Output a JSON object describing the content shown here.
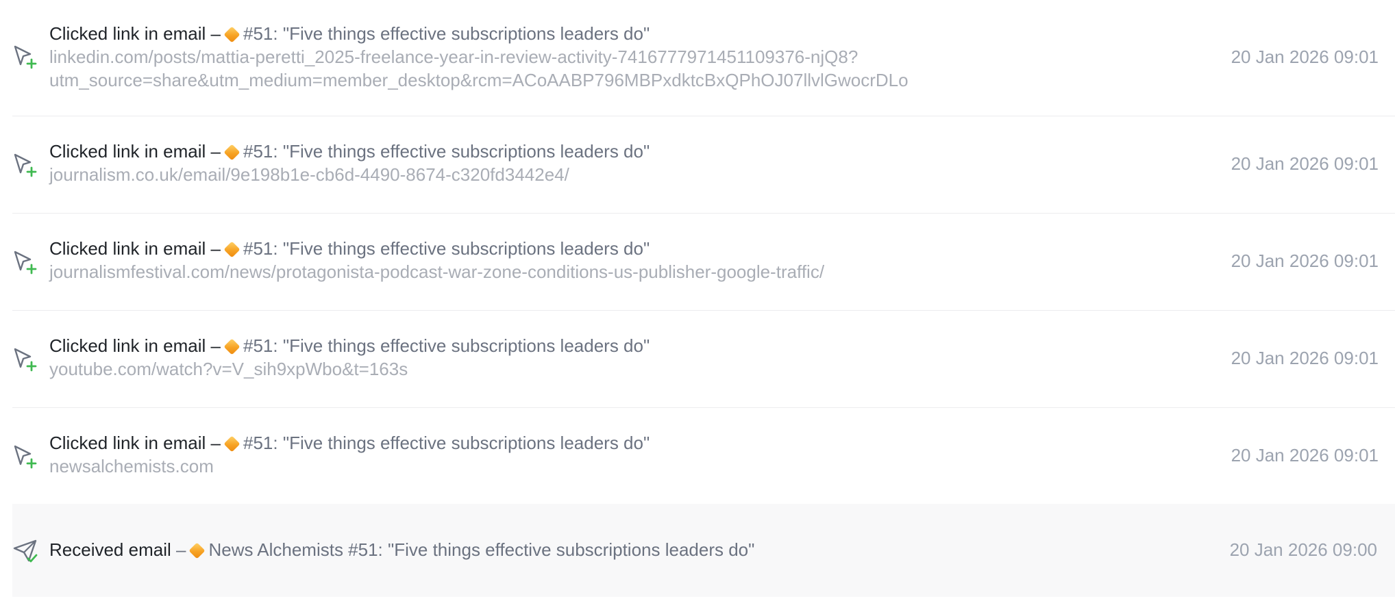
{
  "activities": [
    {
      "type": "click",
      "icon": "cursor-click-icon",
      "event_label": "Clicked link in email",
      "separator": "–",
      "email_label": "#51: \"Five things effective subscriptions leaders do\"",
      "url_line1": "linkedin.com/posts/mattia-peretti_2025-freelance-year-in-review-activity-7416777971451109376-njQ8?",
      "url_line2": "utm_source=share&utm_medium=member_desktop&rcm=ACoAABP796MBPxdktcBxQPhOJ07llvlGwocrDLo",
      "timestamp": "20 Jan 2026 09:01"
    },
    {
      "type": "click",
      "icon": "cursor-click-icon",
      "event_label": "Clicked link in email",
      "separator": "–",
      "email_label": "#51: \"Five things effective subscriptions leaders do\"",
      "url_line1": "journalism.co.uk/email/9e198b1e-cb6d-4490-8674-c320fd3442e4/",
      "timestamp": "20 Jan 2026 09:01"
    },
    {
      "type": "click",
      "icon": "cursor-click-icon",
      "event_label": "Clicked link in email",
      "separator": "–",
      "email_label": "#51: \"Five things effective subscriptions leaders do\"",
      "url_line1": "journalismfestival.com/news/protagonista-podcast-war-zone-conditions-us-publisher-google-traffic/",
      "timestamp": "20 Jan 2026 09:01"
    },
    {
      "type": "click",
      "icon": "cursor-click-icon",
      "event_label": "Clicked link in email",
      "separator": "–",
      "email_label": "#51: \"Five things effective subscriptions leaders do\"",
      "url_line1": "youtube.com/watch?v=V_sih9xpWbo&t=163s",
      "timestamp": "20 Jan 2026 09:01"
    },
    {
      "type": "click",
      "icon": "cursor-click-icon",
      "event_label": "Clicked link in email",
      "separator": "–",
      "email_label": "#51: \"Five things effective subscriptions leaders do\"",
      "url_line1": "newsalchemists.com",
      "timestamp": "20 Jan 2026 09:01"
    },
    {
      "type": "received",
      "icon": "paper-plane-check-icon",
      "event_label": "Received email",
      "separator": "–",
      "email_label": "News Alchemists #51: \"Five things effective subscriptions leaders do\"",
      "timestamp": "20 Jan 2026 09:00"
    }
  ],
  "colors": {
    "event_text": "#1f2328",
    "subject_text": "#6b7280",
    "url_text": "#a9adb5",
    "timestamp_text": "#9ca3af",
    "icon_stroke": "#6b7280",
    "icon_accent": "#3fb950",
    "emoji_diamond": "#f7a325",
    "highlight_row": "#f8f8f9"
  }
}
